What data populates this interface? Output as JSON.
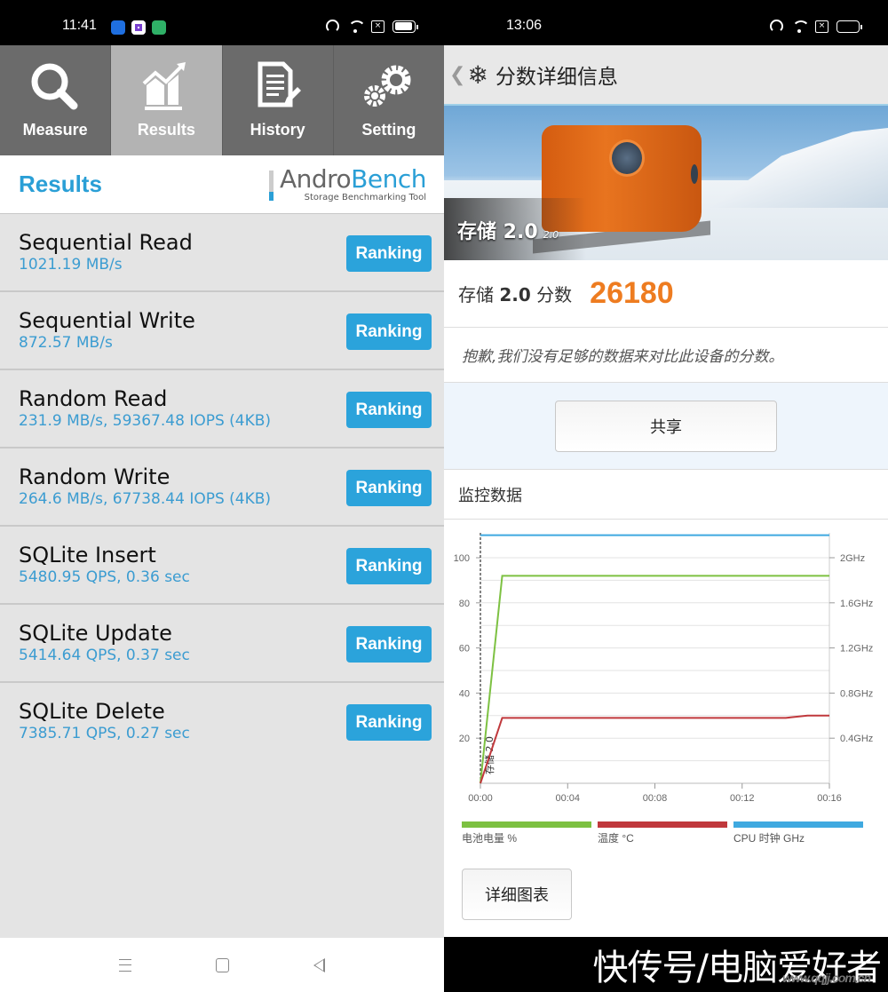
{
  "left": {
    "status": {
      "time": "11:41",
      "notifications": [
        "app-notification-blue",
        "app-notification-purple",
        "app-notification-green"
      ],
      "battery_percent": 95
    },
    "tabs": [
      {
        "label": "Measure",
        "icon": "magnifier-icon",
        "active": false
      },
      {
        "label": "Results",
        "icon": "chart-trend-icon",
        "active": true
      },
      {
        "label": "History",
        "icon": "document-pencil-icon",
        "active": false
      },
      {
        "label": "Setting",
        "icon": "gears-icon",
        "active": false
      }
    ],
    "header": {
      "title": "Results",
      "logo_andro": "Andro",
      "logo_bench": "Bench",
      "logo_tagline": "Storage Benchmarking Tool"
    },
    "results": [
      {
        "name": "Sequential Read",
        "value": "1021.19 MB/s",
        "button": "Ranking"
      },
      {
        "name": "Sequential Write",
        "value": "872.57 MB/s",
        "button": "Ranking"
      },
      {
        "name": "Random Read",
        "value": "231.9 MB/s, 59367.48 IOPS (4KB)",
        "button": "Ranking"
      },
      {
        "name": "Random Write",
        "value": "264.6 MB/s, 67738.44 IOPS (4KB)",
        "button": "Ranking"
      },
      {
        "name": "SQLite Insert",
        "value": "5480.95 QPS, 0.36 sec",
        "button": "Ranking"
      },
      {
        "name": "SQLite Update",
        "value": "5414.64 QPS, 0.37 sec",
        "button": "Ranking"
      },
      {
        "name": "SQLite Delete",
        "value": "7385.71 QPS, 0.27 sec",
        "button": "Ranking"
      }
    ],
    "colors": {
      "accent": "#2ba3db",
      "tab_bg": "#6b6b6b",
      "tab_active_bg": "#b3b3b3"
    }
  },
  "right": {
    "status": {
      "time": "13:06",
      "battery_percent": 0
    },
    "header": {
      "back": "❮",
      "logo_glyph": "❄",
      "title": "分数详细信息"
    },
    "hero": {
      "label": "存储 2.0",
      "version": "2.0"
    },
    "score": {
      "label_prefix": "存储 ",
      "label_bold": "2.0",
      "label_suffix": " 分数",
      "value": "26180"
    },
    "message": "抱歉,我们没有足够的数据来对比此设备的分数。",
    "share_button": "共享",
    "monitor_title": "监控数据",
    "detail_button": "详细图表",
    "colors": {
      "score": "#ee7c20",
      "battery": "#7dc142",
      "temperature": "#c0383c",
      "cpu": "#3fa9e0"
    }
  },
  "watermark": {
    "text": "快传号/电脑爱好者",
    "site": "www.qqjj.com.cn"
  },
  "chart_data": {
    "type": "line",
    "title": "监控数据",
    "xlabel": "",
    "x_ticks": [
      "00:00",
      "00:04",
      "00:08",
      "00:12",
      "00:16"
    ],
    "x_range_minutes": [
      0,
      16
    ],
    "y_left_ticks": [
      20,
      40,
      60,
      80,
      100
    ],
    "y_left_range": [
      0,
      110
    ],
    "y_right_ticks": [
      "0.4GHz",
      "0.8GHz",
      "1.2GHz",
      "1.6GHz",
      "2GHz"
    ],
    "y_right_range_ghz": [
      0,
      2.2
    ],
    "grid": true,
    "legend_position": "bottom",
    "marker": {
      "x_minutes": 0,
      "label": "存储 2.0"
    },
    "series": [
      {
        "name": "电池电量 %",
        "color": "#7dc142",
        "axis": "left",
        "points": [
          [
            0,
            0
          ],
          [
            1,
            92
          ],
          [
            16,
            92
          ]
        ]
      },
      {
        "name": "温度 °C",
        "color": "#c0383c",
        "axis": "left",
        "points": [
          [
            0,
            0
          ],
          [
            1,
            29
          ],
          [
            14,
            29
          ],
          [
            15,
            30
          ],
          [
            16,
            30
          ]
        ]
      },
      {
        "name": "CPU 时钟 GHz",
        "color": "#3fa9e0",
        "axis": "right",
        "points": [
          [
            0,
            2.2
          ],
          [
            16,
            2.2
          ]
        ]
      }
    ]
  }
}
